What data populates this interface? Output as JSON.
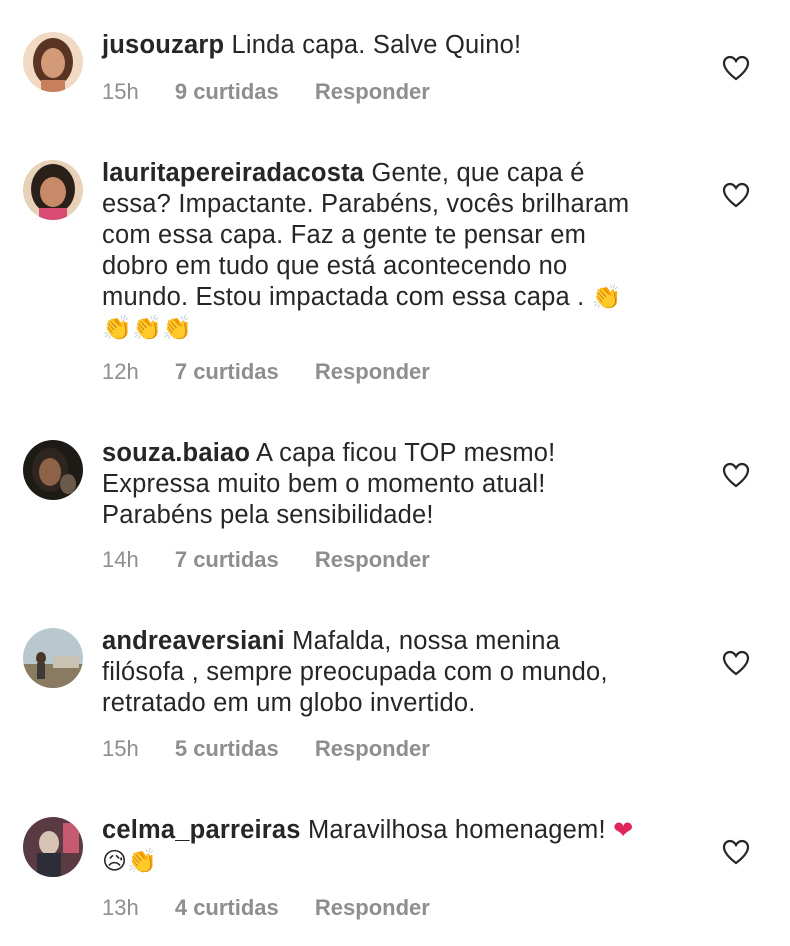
{
  "comments": [
    {
      "username": "jusouzarp",
      "text": "Linda capa. Salve Quino!",
      "time": "15h",
      "likes": "9 curtidas",
      "reply": "Responder"
    },
    {
      "username": "lauritapereiradacosta",
      "text_lines": [
        "Gente, que capa é",
        "essa? Impactante. Parabéns, vocês brilharam",
        "com essa capa. Faz a gente te pensar em",
        "dobro em tudo que está acontecendo no",
        "mundo. Estou impactada com essa capa ."
      ],
      "emoji_inline": "👏",
      "emoji_line": "👏👏👏",
      "time": "12h",
      "likes": "7 curtidas",
      "reply": "Responder"
    },
    {
      "username": "souza.baiao",
      "text_lines": [
        "A capa ficou TOP mesmo!",
        "Expressa muito bem o momento atual!",
        "Parabéns pela sensibilidade!"
      ],
      "time": "14h",
      "likes": "7 curtidas",
      "reply": "Responder"
    },
    {
      "username": "andreaversiani",
      "text_lines": [
        "Mafalda, nossa menina",
        "filósofa , sempre preocupada com o mundo,",
        "retratado em um globo invertido."
      ],
      "time": "15h",
      "likes": "5 curtidas",
      "reply": "Responder"
    },
    {
      "username": "celma_parreiras",
      "text": "Maravilhosa homenagem!",
      "emoji_inline": "❤",
      "emoji_line": "😥👏",
      "time": "13h",
      "likes": "4 curtidas",
      "reply": "Responder"
    }
  ],
  "icons": {
    "like": "heart-outline-icon"
  },
  "colors": {
    "text": "#262626",
    "meta": "#8e8e8e",
    "heart_red": "#e0245e"
  }
}
